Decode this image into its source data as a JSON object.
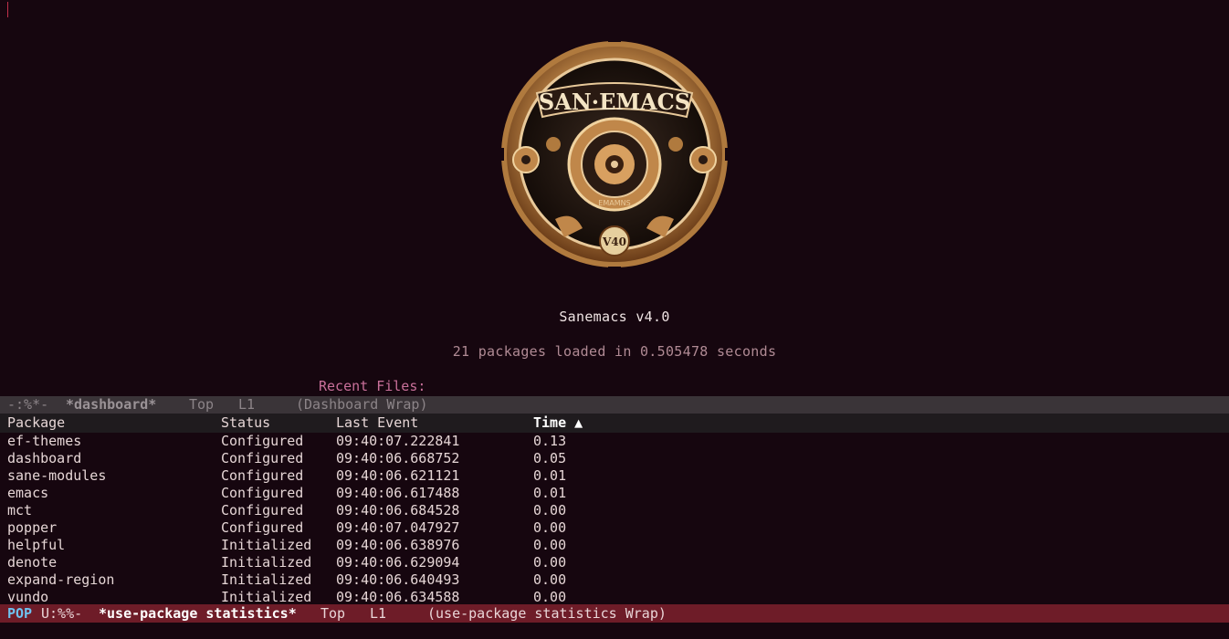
{
  "dashboard": {
    "title": "Sanemacs v4.0",
    "subtitle": "21 packages loaded in 0.505478 seconds",
    "recent_files_label": "Recent Files:",
    "logo": {
      "text": "SAN·EMACS",
      "ring_text": "EMAMNS",
      "version_badge": "V40"
    }
  },
  "modeline_top": {
    "state": "-:%*-",
    "buffer": "*dashboard*",
    "position": "Top",
    "line": "L1",
    "mode": "(Dashboard Wrap)"
  },
  "table": {
    "headers": {
      "package": "Package",
      "status": "Status",
      "last_event": "Last Event",
      "time": "Time ▲"
    },
    "rows": [
      {
        "package": "ef-themes",
        "status": "Configured",
        "last_event": "09:40:07.222841",
        "time": "0.13"
      },
      {
        "package": "dashboard",
        "status": "Configured",
        "last_event": "09:40:06.668752",
        "time": "0.05"
      },
      {
        "package": "sane-modules",
        "status": "Configured",
        "last_event": "09:40:06.621121",
        "time": "0.01"
      },
      {
        "package": "emacs",
        "status": "Configured",
        "last_event": "09:40:06.617488",
        "time": "0.01"
      },
      {
        "package": "mct",
        "status": "Configured",
        "last_event": "09:40:06.684528",
        "time": "0.00"
      },
      {
        "package": "popper",
        "status": "Configured",
        "last_event": "09:40:07.047927",
        "time": "0.00"
      },
      {
        "package": "helpful",
        "status": "Initialized",
        "last_event": "09:40:06.638976",
        "time": "0.00"
      },
      {
        "package": "denote",
        "status": "Initialized",
        "last_event": "09:40:06.629094",
        "time": "0.00"
      },
      {
        "package": "expand-region",
        "status": "Initialized",
        "last_event": "09:40:06.640493",
        "time": "0.00"
      },
      {
        "package": "vundo",
        "status": "Initialized",
        "last_event": "09:40:06.634588",
        "time": "0.00"
      }
    ]
  },
  "modeline_bottom": {
    "pop": "POP",
    "state": "U:%%-",
    "buffer": "*use-package statistics*",
    "position": "Top",
    "line": "L1",
    "mode": "(use-package statistics Wrap)"
  },
  "colors": {
    "background": "#16060f",
    "active_modeline": "#6e1c28",
    "inactive_modeline": "#3a3438",
    "accent_pink": "#c9709a",
    "pop_blue": "#6fc2f0"
  }
}
